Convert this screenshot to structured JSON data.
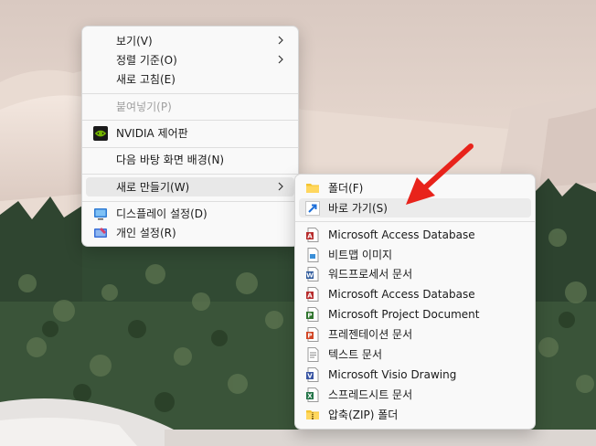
{
  "main_menu": {
    "items": [
      {
        "label": "보기(V)"
      },
      {
        "label": "정렬 기준(O)"
      },
      {
        "label": "새로 고침(E)"
      },
      {
        "label": "붙여넣기(P)"
      },
      {
        "label": "NVIDIA 제어판"
      },
      {
        "label": "다음 바탕 화면 배경(N)"
      },
      {
        "label": "새로 만들기(W)"
      },
      {
        "label": "디스플레이 설정(D)"
      },
      {
        "label": "개인 설정(R)"
      }
    ]
  },
  "sub_menu": {
    "items": [
      {
        "label": "폴더(F)"
      },
      {
        "label": "바로 가기(S)"
      },
      {
        "label": "Microsoft Access Database"
      },
      {
        "label": "비트맵 이미지"
      },
      {
        "label": "워드프로세서 문서"
      },
      {
        "label": "Microsoft Access Database"
      },
      {
        "label": "Microsoft Project Document"
      },
      {
        "label": "프레젠테이션 문서"
      },
      {
        "label": "텍스트 문서"
      },
      {
        "label": "Microsoft Visio Drawing"
      },
      {
        "label": "스프레드시트 문서"
      },
      {
        "label": "압축(ZIP) 폴더"
      }
    ]
  },
  "colors": {
    "arrow": "#e8231b",
    "menu_bg": "#f9f9f9",
    "highlight": "#e8e8e8",
    "nvidia_green": "#76b900"
  }
}
